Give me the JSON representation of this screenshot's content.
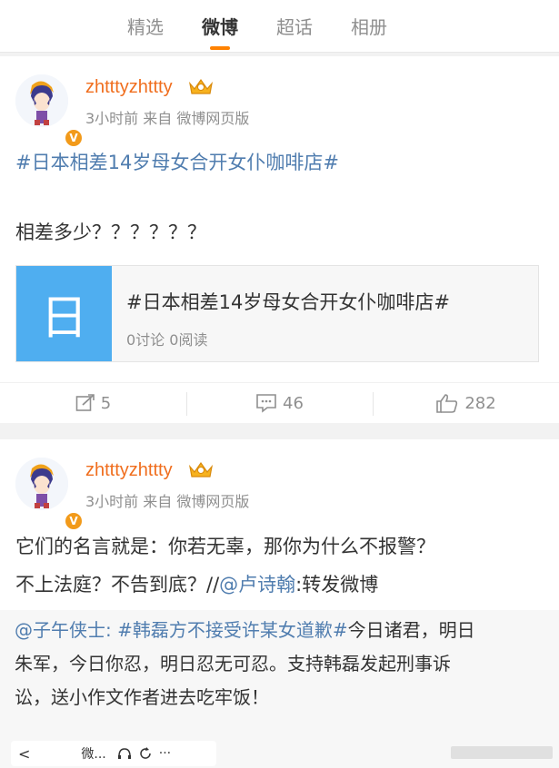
{
  "tabs": [
    {
      "label": "精选",
      "active": false
    },
    {
      "label": "微博",
      "active": true
    },
    {
      "label": "超话",
      "active": false
    },
    {
      "label": "相册",
      "active": false
    }
  ],
  "accent_color": "#ff8200",
  "posts": [
    {
      "username": "zhtttyzhttty",
      "meta": "3小时前 来自 微博网页版",
      "verified_badge": "V",
      "topic_line": "#日本相差14岁母女合开女仆咖啡店#",
      "body": "相差多少？？？？？？",
      "topic_card": {
        "thumb_char": "日",
        "title": "#日本相差14岁母女合开女仆咖啡店#",
        "stats": "0讨论 0阅读"
      },
      "actions": {
        "repost": "5",
        "comment": "46",
        "like": "282"
      }
    },
    {
      "username": "zhtttyzhttty",
      "meta": "3小时前 来自 微博网页版",
      "verified_badge": "V",
      "line1": "它们的名言就是：你若无辜，那你为什么不报警？",
      "line2_prefix": "不上法庭？不告到底？//",
      "line2_mention": "@卢诗翰",
      "line2_suffix": ":转发微博",
      "retweet": {
        "author": "@子午侠士",
        "sep": ": ",
        "topic": "#韩磊方不接受许某女道歉#",
        "rest1": "今日诸君，明日",
        "line2": "朱军，今日你忍，明日忍无可忍。支持韩磊发起刑事诉",
        "line3": "讼，送小作文作者进去吃牢饭！"
      }
    }
  ],
  "video_bar": {
    "back": "<",
    "title": "微...",
    "dots": "···"
  }
}
